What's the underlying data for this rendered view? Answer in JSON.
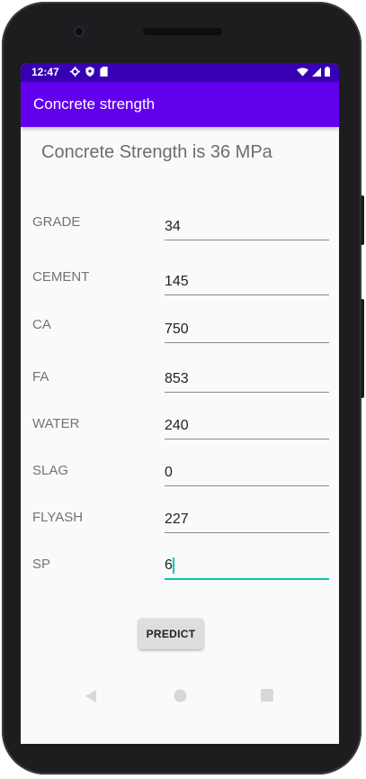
{
  "status_bar": {
    "time": "12:47"
  },
  "app_bar": {
    "title": "Concrete strength"
  },
  "result_text": "Concrete Strength is 36 MPa",
  "fields": [
    {
      "label": "GRADE",
      "value": "34"
    },
    {
      "label": "CEMENT",
      "value": "145"
    },
    {
      "label": "CA",
      "value": "750"
    },
    {
      "label": "FA",
      "value": "853"
    },
    {
      "label": "WATER",
      "value": "240"
    },
    {
      "label": "SLAG",
      "value": "0"
    },
    {
      "label": "FLYASH",
      "value": "227"
    },
    {
      "label": "SP",
      "value": "6"
    }
  ],
  "predict_button": {
    "label": "PREDICT"
  },
  "colors": {
    "status_bar": "#3700b3",
    "app_bar": "#6200ee",
    "focus_accent": "#03c4b0"
  },
  "icons": {
    "status_left": [
      "settings-icon",
      "shield-icon",
      "sd-card-icon"
    ],
    "status_right": [
      "wifi-icon",
      "signal-icon",
      "battery-icon"
    ],
    "nav": [
      "back-icon",
      "home-icon",
      "recents-icon"
    ]
  }
}
